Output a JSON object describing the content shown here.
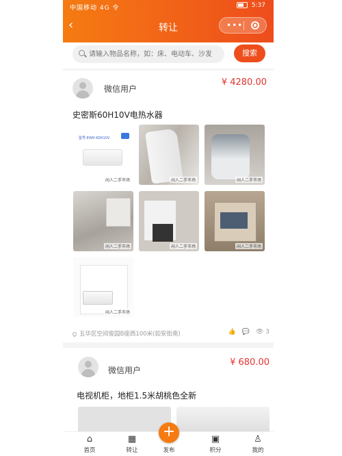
{
  "status_bar": {
    "left": "中国移动 4G 令",
    "time": "5:37"
  },
  "header": {
    "back": "‹",
    "title": "转让",
    "more": "•••"
  },
  "search": {
    "placeholder": "请输入物品名称，如：床、电动车、沙发",
    "button": "搜索"
  },
  "listings": [
    {
      "user": "微信用户",
      "price": "¥ 4280.00",
      "title": "史密斯60H10V电热水器",
      "photo_label": "型号:EWH-60H10V",
      "photo_badge": "60L",
      "watermark": "闲人二手市场",
      "location": "五华区空间俊园B座西100米(如安街南)",
      "likes": "",
      "comments": "",
      "views": "3"
    },
    {
      "user": "微信用户",
      "price": "¥ 680.00",
      "title": "电视机柜，地柜1.5米胡桃色全新"
    }
  ],
  "tabbar": {
    "items": [
      "首页",
      "转让",
      "发布",
      "积分",
      "我的"
    ],
    "fab": "+"
  }
}
